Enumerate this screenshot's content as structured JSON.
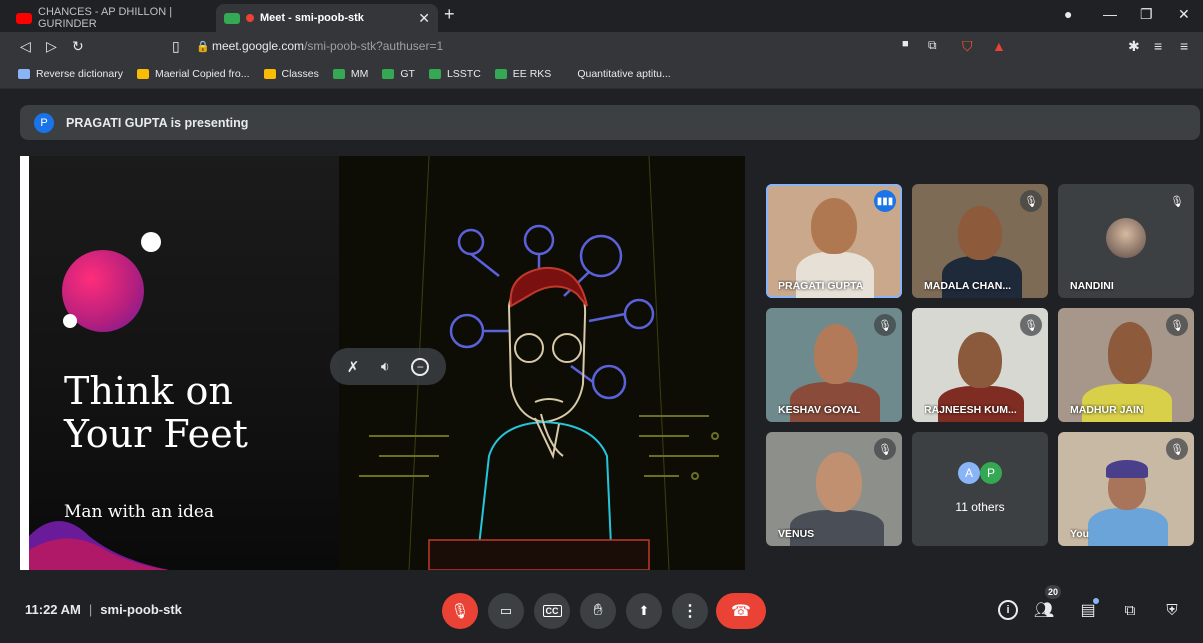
{
  "browser": {
    "tabs": [
      {
        "title": "CHANCES - AP DHILLON | GURINDER",
        "active": false
      },
      {
        "title": "Meet - smi-poob-stk",
        "active": true
      }
    ],
    "url_host": "meet.google.com",
    "url_rest": "/smi-poob-stk?authuser=1",
    "bookmarks": [
      {
        "label": "Reverse dictionary",
        "color": "#8ab4f8"
      },
      {
        "label": "Maerial Copied fro...",
        "color": "#fbbc04"
      },
      {
        "label": "Classes",
        "color": "#fbbc04"
      },
      {
        "label": "MM",
        "color": "#34a853"
      },
      {
        "label": "GT",
        "color": "#34a853"
      },
      {
        "label": "LSSTC",
        "color": "#34a853"
      },
      {
        "label": "EE RKS",
        "color": "#34a853"
      },
      {
        "label": "Quantitative aptitu...",
        "color": ""
      }
    ]
  },
  "banner": {
    "avatar_letter": "P",
    "text": "PRAGATI GUPTA is presenting"
  },
  "slide": {
    "title_line1": "Think on",
    "title_line2": "Your Feet",
    "subtitle": "Man with an idea"
  },
  "participants": [
    {
      "name": "PRAGATI GUPTA",
      "speaking": true
    },
    {
      "name": "MADALA CHAN...",
      "muted": true
    },
    {
      "name": "NANDINI",
      "muted": true
    },
    {
      "name": "KESHAV GOYAL",
      "muted": true
    },
    {
      "name": "RAJNEESH KUM...",
      "muted": true
    },
    {
      "name": "MADHUR JAIN",
      "muted": true
    },
    {
      "name": "VENUS",
      "muted": true
    },
    {
      "name": "You",
      "muted": true
    }
  ],
  "others": {
    "avatars": [
      "A",
      "P"
    ],
    "label": "11 others"
  },
  "bottom": {
    "time": "11:22 AM",
    "meeting_code": "smi-poob-stk",
    "people_count": "20"
  },
  "colors": {
    "accent": "#8ab4f8",
    "danger": "#ea4335",
    "tile": "#3c4043",
    "background": "#202124"
  }
}
